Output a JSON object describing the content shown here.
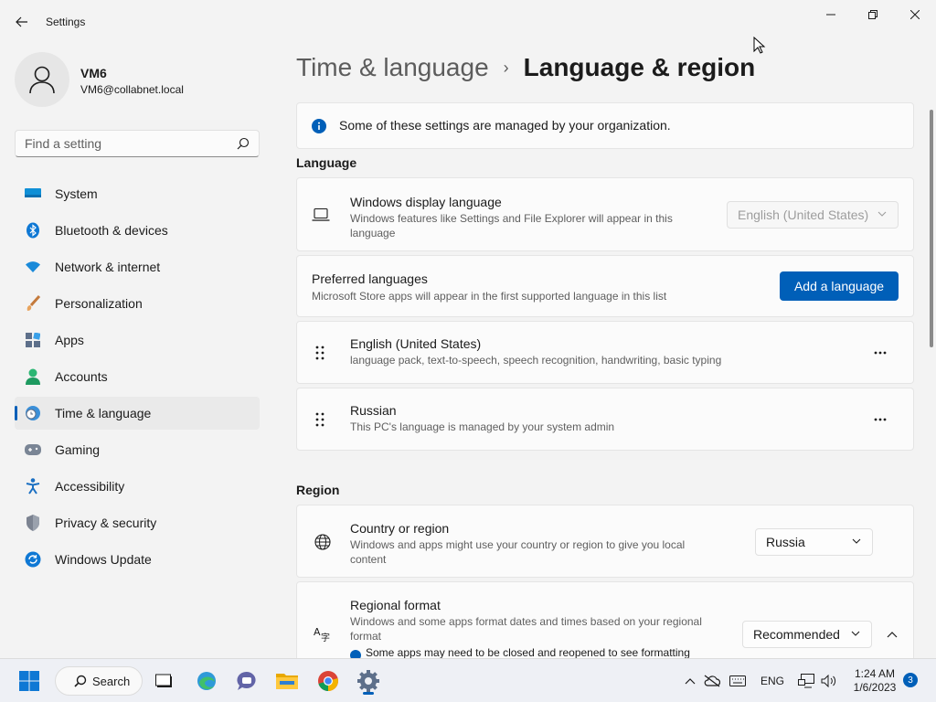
{
  "window": {
    "title": "Settings",
    "controls": [
      "minimize",
      "restore",
      "close"
    ]
  },
  "user": {
    "name": "VM6",
    "email": "VM6@collabnet.local"
  },
  "search": {
    "placeholder": "Find a setting"
  },
  "sidebar": {
    "items": [
      {
        "label": "System",
        "icon": "system-icon",
        "active": false
      },
      {
        "label": "Bluetooth & devices",
        "icon": "bluetooth-icon",
        "active": false
      },
      {
        "label": "Network & internet",
        "icon": "wifi-icon",
        "active": false
      },
      {
        "label": "Personalization",
        "icon": "brush-icon",
        "active": false
      },
      {
        "label": "Apps",
        "icon": "apps-icon",
        "active": false
      },
      {
        "label": "Accounts",
        "icon": "accounts-icon",
        "active": false
      },
      {
        "label": "Time & language",
        "icon": "time-language-icon",
        "active": true
      },
      {
        "label": "Gaming",
        "icon": "gamepad-icon",
        "active": false
      },
      {
        "label": "Accessibility",
        "icon": "accessibility-icon",
        "active": false
      },
      {
        "label": "Privacy & security",
        "icon": "shield-icon",
        "active": false
      },
      {
        "label": "Windows Update",
        "icon": "windows-update-icon",
        "active": false
      }
    ]
  },
  "breadcrumb": {
    "parent": "Time & language",
    "separator": "›",
    "current": "Language & region"
  },
  "info_bar": {
    "text": "Some of these settings are managed by your organization."
  },
  "language_section": {
    "heading": "Language",
    "display_language": {
      "title": "Windows display language",
      "description": "Windows features like Settings and File Explorer will appear in this language",
      "value": "English (United States)",
      "disabled": true
    },
    "preferred": {
      "title": "Preferred languages",
      "description": "Microsoft Store apps will appear in the first supported language in this list",
      "button": "Add a language"
    },
    "languages": [
      {
        "name": "English (United States)",
        "details": "language pack, text-to-speech, speech recognition, handwriting, basic typing"
      },
      {
        "name": "Russian",
        "details": "This PC's language is managed by your system admin"
      }
    ],
    "more_glyph": "···"
  },
  "region_section": {
    "heading": "Region",
    "country": {
      "title": "Country or region",
      "description": "Windows and apps might use your country or region to give you local content",
      "value": "Russia"
    },
    "format": {
      "title": "Regional format",
      "description": "Windows and some apps format dates and times based on your regional format",
      "value": "Recommended",
      "note": "Some apps may need to be closed and reopened to see formatting"
    }
  },
  "taskbar": {
    "search_label": "Search",
    "apps": [
      "start-icon",
      "task-view-icon",
      "edge-icon",
      "teams-chat-icon",
      "file-explorer-icon",
      "chrome-icon",
      "settings-icon"
    ],
    "language": "ENG",
    "time": "1:24 AM",
    "date": "1/6/2023",
    "notification_count": "3"
  },
  "colors": {
    "accent": "#005fb8",
    "background": "#f3f3f3",
    "card": "#fbfbfb",
    "secondary_text": "#5f5f5f"
  }
}
